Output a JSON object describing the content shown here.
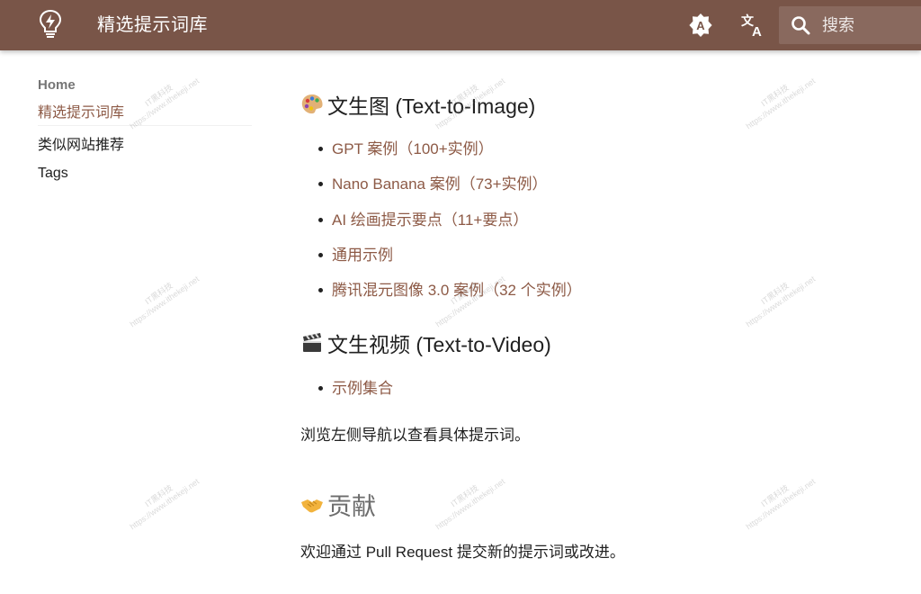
{
  "header": {
    "title": "精选提示词库",
    "search_placeholder": "搜索",
    "colors": {
      "primary": "#795548",
      "link": "#8d5a46"
    },
    "icons": [
      "lightbulb-bolt-icon",
      "theme-toggle-icon",
      "translate-icon",
      "search-icon"
    ]
  },
  "sidebar": {
    "home_label": "Home",
    "items": [
      {
        "label": "精选提示词库",
        "active": true
      },
      {
        "label": "类似网站推荐",
        "active": false
      },
      {
        "label": "Tags",
        "active": false
      }
    ]
  },
  "main": {
    "section1": {
      "emoji": "palette-emoji",
      "heading": "文生图 (Text-to-Image)",
      "links": [
        "GPT 案例（100+实例）",
        "Nano Banana 案例（73+实例）",
        "AI 绘画提示要点（11+要点）",
        "通用示例",
        "腾讯混元图像 3.0 案例（32 个实例）"
      ]
    },
    "section2": {
      "emoji": "clapper-board-emoji",
      "heading": "文生视频 (Text-to-Video)",
      "links": [
        "示例集合"
      ]
    },
    "browse_note": "浏览左侧导航以查看具体提示词。",
    "contribute": {
      "emoji": "handshake-emoji",
      "heading": "贡献",
      "text": "欢迎通过 Pull Request 提交新的提示词或改进。"
    }
  },
  "watermark": {
    "line1": "IT黑科技",
    "line2": "https://www.ithekeji.net"
  }
}
